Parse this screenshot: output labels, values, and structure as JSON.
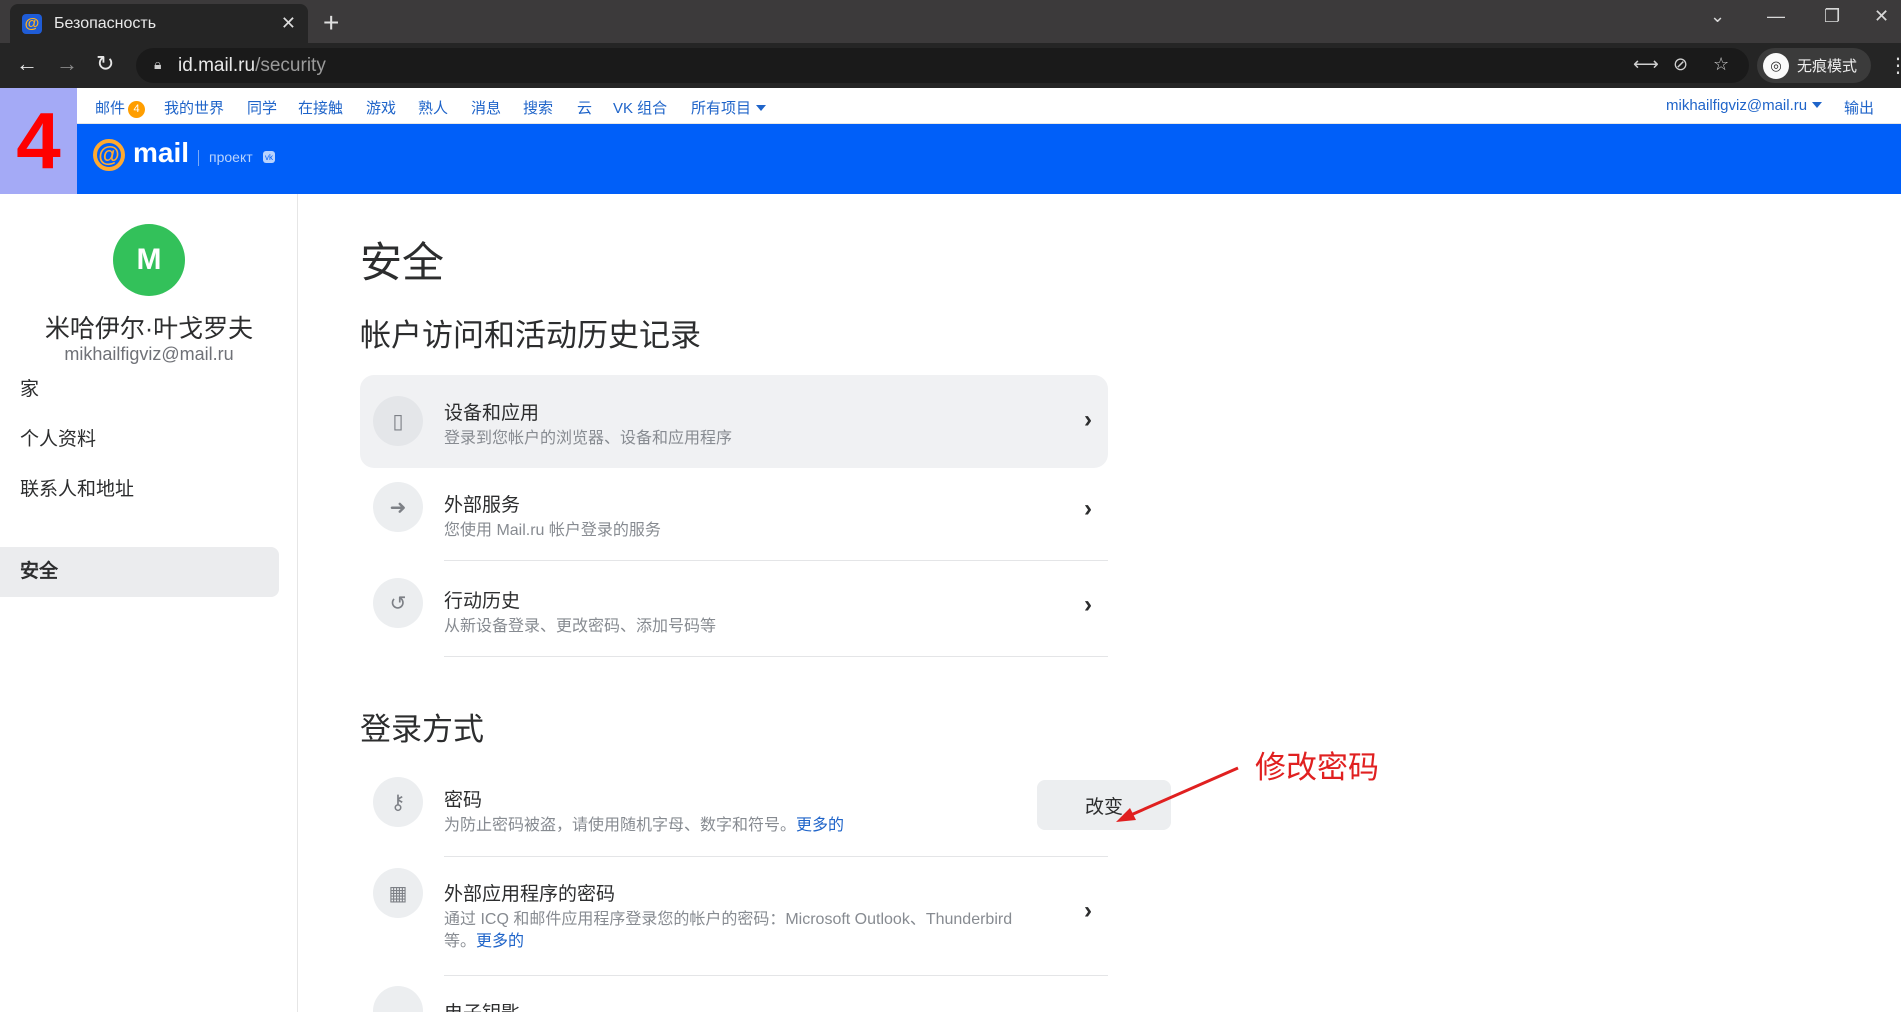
{
  "browser": {
    "tab_title": "Безопасность",
    "favicon": "@",
    "tab_close": "✕",
    "new_tab": "+",
    "url_host": "id.mail.ru",
    "url_path": "/security",
    "incognito_label": "无痕模式"
  },
  "portal_nav": {
    "items": [
      "邮件",
      "我的世界",
      "同学",
      "在接触",
      "游戏",
      "熟人",
      "消息",
      "搜索",
      "云",
      "VK 组合",
      "所有项目"
    ],
    "mail_count": "4",
    "account": "mikhailfigviz@mail.ru",
    "logout": "输出"
  },
  "logo": {
    "at": "@",
    "word": "mail",
    "project": "проект",
    "vk": "vk"
  },
  "step_badge": "4",
  "sidebar": {
    "avatar_letter": "M",
    "user_name": "米哈伊尔·叶戈罗夫",
    "user_email": "mikhailfigviz@mail.ru",
    "items": [
      "家",
      "个人资料",
      "联系人和地址",
      "安全"
    ],
    "active_index": 3
  },
  "main": {
    "page_title": "安全",
    "section1_title": "帐户访问和活动历史记录",
    "section1_rows": [
      {
        "title": "设备和应用",
        "subtitle": "登录到您帐户的浏览器、设备和应用程序",
        "icon": "phone-icon"
      },
      {
        "title": "外部服务",
        "subtitle": "您使用 Mail.ru 帐户登录的服务",
        "icon": "arrow-right-icon"
      },
      {
        "title": "行动历史",
        "subtitle": "从新设备登录、更改密码、添加号码等",
        "icon": "history-icon"
      }
    ],
    "section2_title": "登录方式",
    "password_row": {
      "title": "密码",
      "subtitle": "为防止密码被盗，请使用随机字母、数字和符号。",
      "more": "更多的",
      "button": "改变",
      "icon": "key-icon"
    },
    "app_password_row": {
      "title": "外部应用程序的密码",
      "subtitle": "通过 ICQ 和邮件应用程序登录您的帐户的密码：Microsoft Outlook、Thunderbird 等。",
      "more": "更多的",
      "icon": "grid-icon"
    },
    "partial_row_title": "电子钥匙"
  },
  "annotation": "修改密码",
  "colors": {
    "brand_blue": "#005ff9",
    "link": "#1f64c9",
    "avatar_green": "#33c15a",
    "annotation_red": "#e02020",
    "mail_badge": "#ff9e00"
  }
}
